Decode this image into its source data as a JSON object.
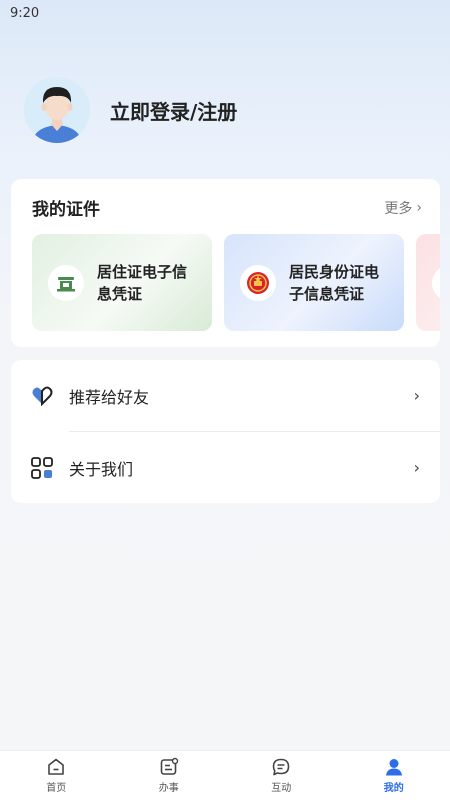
{
  "status_bar": {
    "time": "9:20"
  },
  "profile": {
    "login_label": "立即登录/注册"
  },
  "certificates": {
    "title": "我的证件",
    "more_label": "更多",
    "items": [
      {
        "label_line1": "居住证电子信",
        "label_line2": "息凭证",
        "icon": "residence-permit-emblem-icon"
      },
      {
        "label_line1": "居民身份证电",
        "label_line2": "子信息凭证",
        "icon": "national-emblem-icon"
      }
    ]
  },
  "menu": {
    "items": [
      {
        "label": "推荐给好友",
        "icon": "heart-share-icon"
      },
      {
        "label": "关于我们",
        "icon": "grid-apps-icon"
      }
    ]
  },
  "tabbar": {
    "tabs": [
      {
        "label": "首页",
        "icon": "home-icon"
      },
      {
        "label": "办事",
        "icon": "service-icon"
      },
      {
        "label": "互动",
        "icon": "chat-icon"
      },
      {
        "label": "我的",
        "icon": "person-icon"
      }
    ],
    "active_index": 3
  },
  "colors": {
    "accent": "#2d6ee8",
    "avatar_shirt": "#4a7fd6",
    "emblem_green": "#4a8a4e",
    "emblem_red": "#d8232a"
  }
}
